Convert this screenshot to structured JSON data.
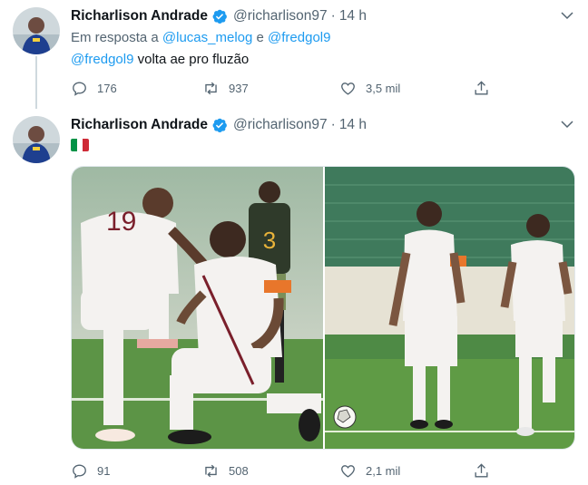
{
  "tweets": [
    {
      "author_name": "Richarlison Andrade",
      "author_handle": "@richarlison97",
      "separator": "·",
      "time": "14 h",
      "reply_prefix": "Em resposta a",
      "reply_mention_1": "@lucas_melog",
      "reply_conjunction": "e",
      "reply_mention_2": "@fredgol9",
      "text_mention": "@fredgol9",
      "text_rest": " volta ae pro fluzão",
      "reply_count": "176",
      "retweet_count": "937",
      "like_count": "3,5 mil"
    },
    {
      "author_name": "Richarlison Andrade",
      "author_handle": "@richarlison97",
      "separator": "·",
      "time": "14 h",
      "flag_colors": [
        "#009246",
        "#ffffff",
        "#ce2b37"
      ],
      "reply_count": "91",
      "retweet_count": "508",
      "like_count": "2,1 mil",
      "photo_jersey_number_1": "19",
      "photo_jersey_number_2": "3"
    }
  ],
  "colors": {
    "accent": "#1d9bf0",
    "secondary_text": "#536471",
    "text": "#0f1419",
    "pitch_green": "#4c8a3a",
    "jersey_white": "#f4f2f0",
    "fluminense_garnet": "#7a1f2b"
  },
  "icons": [
    "verified-badge-icon",
    "chevron-down-icon",
    "reply-icon",
    "retweet-icon",
    "like-icon",
    "share-icon"
  ]
}
